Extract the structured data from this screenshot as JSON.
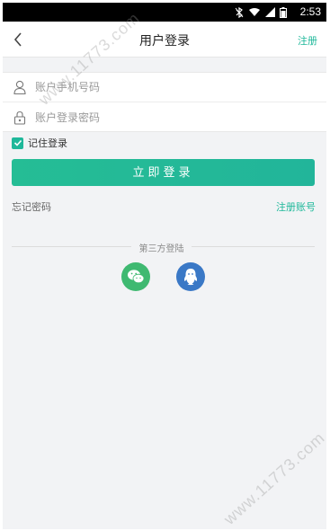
{
  "status_bar": {
    "time": "2:53"
  },
  "nav": {
    "title": "用户登录",
    "register_label": "注册"
  },
  "form": {
    "phone_placeholder": "账户手机号码",
    "password_placeholder": "账户登录密码"
  },
  "remember": {
    "label": "记住登录",
    "checked": true
  },
  "login_button": "立即登录",
  "links": {
    "forgot": "忘记密码",
    "register_account": "注册账号"
  },
  "third_party": {
    "label": "第三方登陆",
    "providers": [
      "wechat",
      "qq"
    ]
  },
  "watermark": "www.11773.com",
  "colors": {
    "accent": "#1fb89a",
    "wechat": "#3fb971",
    "qq": "#3a78c6"
  },
  "icons": [
    "back-arrow-icon",
    "user-icon",
    "lock-icon",
    "check-icon",
    "wechat-icon",
    "qq-icon"
  ]
}
